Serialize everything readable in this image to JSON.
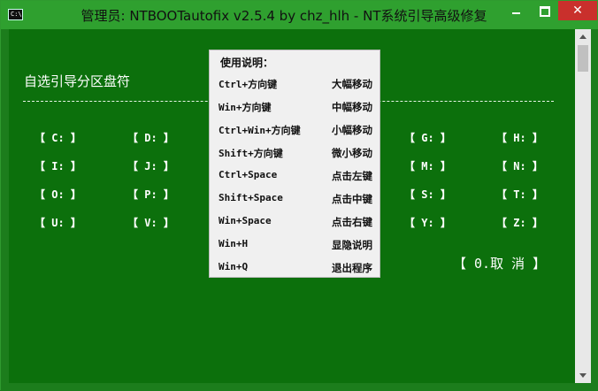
{
  "window": {
    "title": "管理员:  NTBOOTautofix v2.5.4 by chz_hlh - NT系统引导高级修复",
    "icon_text": "C:\\",
    "close_glyph": "✕"
  },
  "main": {
    "heading": "自选引导分区盘符",
    "drives": [
      [
        "【 C: 】",
        "【 D: 】",
        "",
        "",
        "【 G: 】",
        "【 H: 】"
      ],
      [
        "【 I: 】",
        "【 J: 】",
        "",
        "",
        "【 M: 】",
        "【 N: 】"
      ],
      [
        "【 O: 】",
        "【 P: 】",
        "",
        "",
        "【 S: 】",
        "【 T: 】"
      ],
      [
        "【 U: 】",
        "【 V: 】",
        "",
        "",
        "【 Y: 】",
        "【 Z: 】"
      ]
    ],
    "cancel_label": "【 0.取  消 】"
  },
  "help": {
    "title": "使用说明：",
    "rows": [
      {
        "key": "Ctrl+方向键",
        "desc": "大幅移动"
      },
      {
        "key": "Win+方向键",
        "desc": "中幅移动"
      },
      {
        "key": "Ctrl+Win+方向键",
        "desc": "小幅移动"
      },
      {
        "key": "Shift+方向键",
        "desc": "微小移动"
      },
      {
        "key": "Ctrl+Space",
        "desc": "点击左键"
      },
      {
        "key": "Shift+Space",
        "desc": "点击中键"
      },
      {
        "key": "Win+Space",
        "desc": "点击右键"
      },
      {
        "key": "Win+H",
        "desc": "显隐说明"
      },
      {
        "key": "Win+Q",
        "desc": "退出程序"
      }
    ]
  },
  "colors": {
    "background": "#0c700c",
    "titlebar": "#2fa02f",
    "close": "#c9302c",
    "text": "#ffffff",
    "help_bg": "#f0f0f0"
  }
}
